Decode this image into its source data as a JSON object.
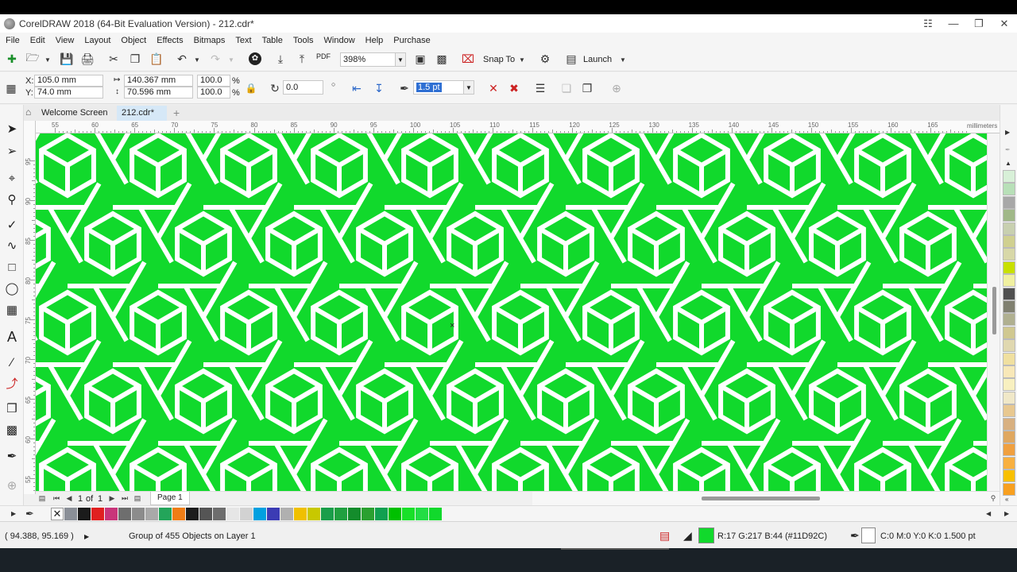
{
  "window": {
    "title": "CorelDRAW 2018 (64-Bit Evaluation Version) - 212.cdr*",
    "buttons": [
      "help",
      "minimize",
      "maximize",
      "close"
    ]
  },
  "menu": [
    "File",
    "Edit",
    "View",
    "Layout",
    "Object",
    "Effects",
    "Bitmaps",
    "Text",
    "Table",
    "Tools",
    "Window",
    "Help",
    "Purchase"
  ],
  "standard_toolbar": {
    "zoom_value": "398%",
    "snap_to_label": "Snap To",
    "launch_label": "Launch",
    "pdf_label": "PDF"
  },
  "property_bar": {
    "x_label": "X:",
    "x_value": "105.0 mm",
    "y_label": "Y:",
    "y_value": "74.0 mm",
    "width_value": "140.367 mm",
    "height_value": "70.596 mm",
    "scale_x": "100.0",
    "scale_y": "100.0",
    "percent": "%",
    "rotation_value": "0.0",
    "outline_width": "1.5 pt"
  },
  "doc_tabs": {
    "welcome": "Welcome Screen",
    "active": "212.cdr*",
    "add": "+"
  },
  "ruler": {
    "h_numbers": [
      "55",
      "60",
      "65",
      "70",
      "75",
      "80",
      "85",
      "90",
      "95",
      "100",
      "105",
      "110",
      "115",
      "120",
      "125",
      "130",
      "135",
      "140",
      "145",
      "150",
      "155",
      "160",
      "165"
    ],
    "unit": "millimeters",
    "v_numbers": [
      "95",
      "90",
      "85",
      "80",
      "75",
      "70",
      "65",
      "60",
      "55"
    ]
  },
  "canvas": {
    "pattern_color": "#11D92C",
    "background": "#FFFFFF",
    "cursor_glyph": "×"
  },
  "page_nav": {
    "page_index": "1",
    "of_label": "of",
    "page_total": "1",
    "page_tab": "Page 1"
  },
  "palette_colors": [
    "#ffffff",
    "#8a8f97",
    "#1b1b1b",
    "#e02020",
    "#c8357a",
    "#6e6e6e",
    "#8c8c8c",
    "#a9a9a9",
    "#23a55a",
    "#ef7d16",
    "#1c1c1c",
    "#555555",
    "#6d6d6d",
    "#e6e6e6",
    "#d2d2d2",
    "#00a0e0",
    "#3c3cb4",
    "#b0b0b0",
    "#f0c000",
    "#c8c800",
    "#1a9e4a",
    "#20a040",
    "#148c2c",
    "#2aa030",
    "#11a050",
    "#00c000",
    "#18e028",
    "#22dd44",
    "#11d92c"
  ],
  "right_palette": [
    "#d8f0d8",
    "#b8e0b8",
    "#a8a8a8",
    "#a0b888",
    "#c8d0b0",
    "#d0d090",
    "#d8d8a8",
    "#c8e000",
    "#f0f0a0",
    "#505050",
    "#808070",
    "#b0b090",
    "#d0c890",
    "#e0d8b0",
    "#f0e0a0",
    "#f8e8b8",
    "#f8f0c0",
    "#f0e8c8",
    "#e8c890",
    "#d8b080",
    "#e0a860",
    "#f0a040",
    "#f8b040",
    "#f8c000",
    "#f8a020"
  ],
  "status": {
    "coords": "( 94.388, 95.169 )",
    "selection": "Group of 455 Objects on Layer 1",
    "fill_info": "R:17 G:217 B:44 (#11D92C)",
    "fill_color": "#11D92C",
    "outline_info": "C:0 M:0 Y:0 K:0  1.500 pt"
  }
}
